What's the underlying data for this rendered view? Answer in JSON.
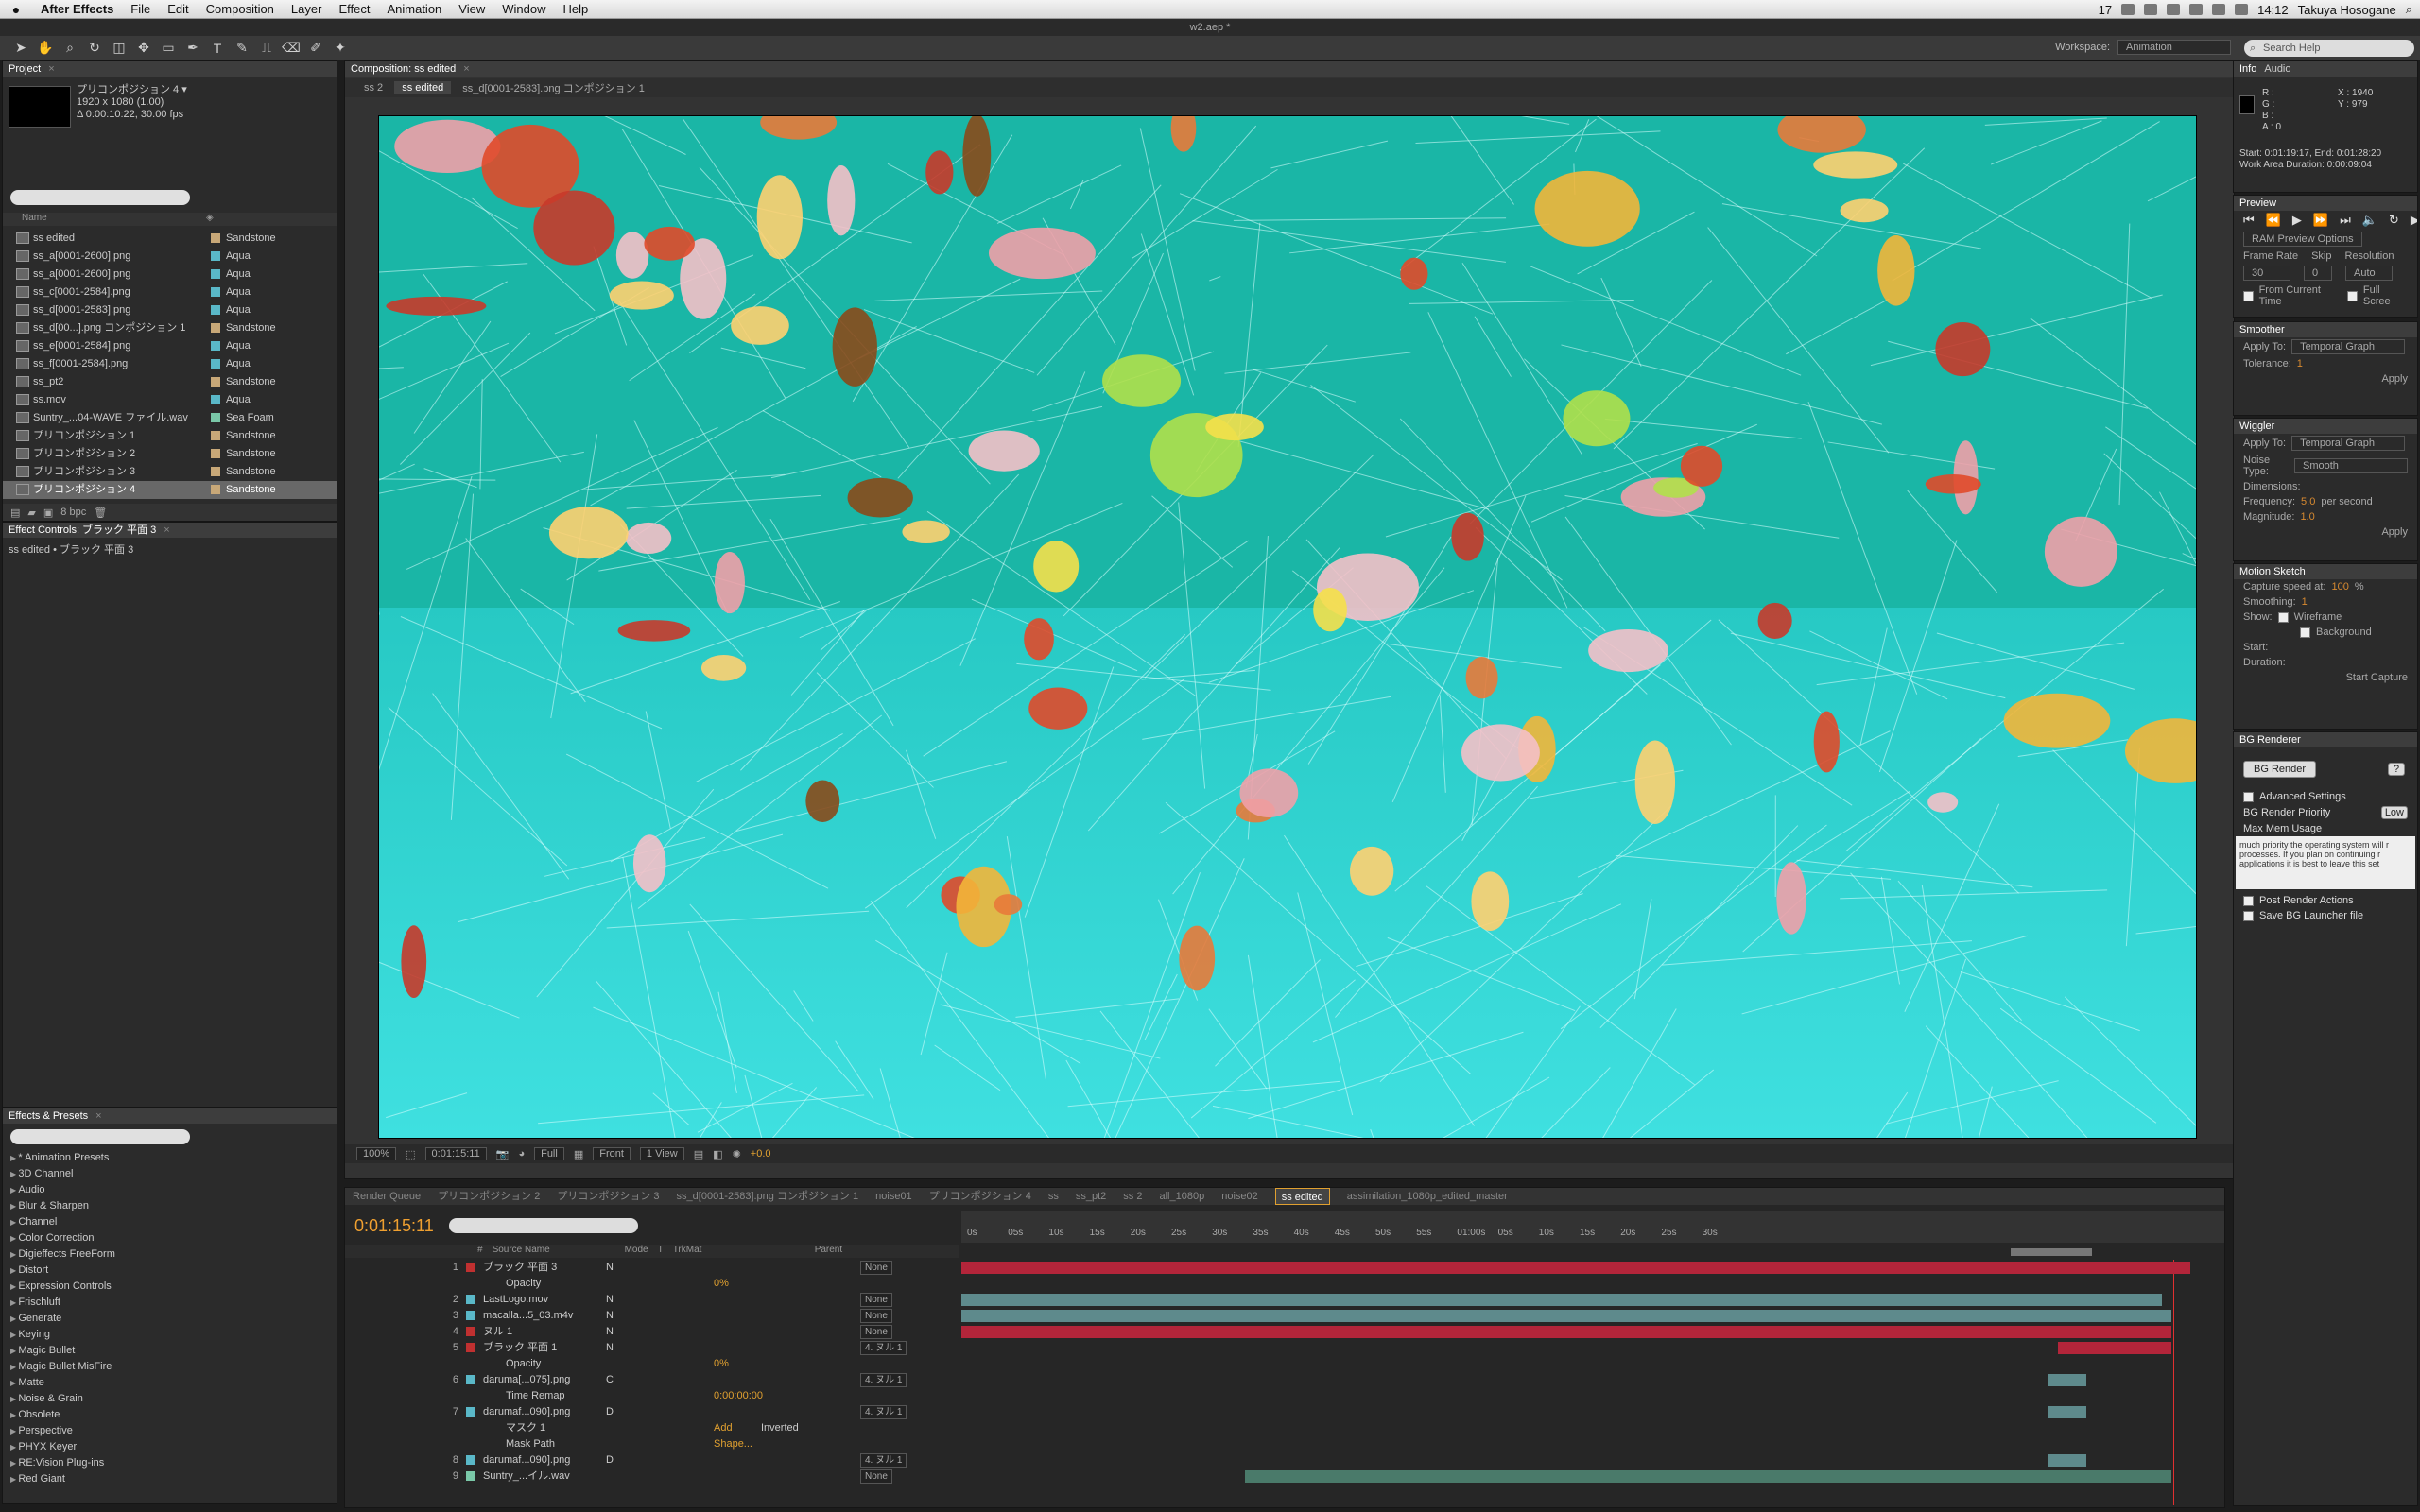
{
  "menubar": {
    "app": "After Effects",
    "menus": [
      "File",
      "Edit",
      "Composition",
      "Layer",
      "Effect",
      "Animation",
      "View",
      "Window",
      "Help"
    ],
    "status_count": "17",
    "clock": "14:12",
    "user": "Takuya Hosogane"
  },
  "window": {
    "title": "w2.aep *"
  },
  "toolbar": {
    "workspace_label": "Workspace:",
    "workspace_value": "Animation",
    "search_help": "Search Help"
  },
  "project": {
    "tab": "Project",
    "selected_name": "プリコンポジション 4 ▾",
    "selected_info": [
      "1920 x 1080 (1.00)",
      "Δ 0:00:10:22, 30.00 fps"
    ],
    "col_name": "Name",
    "items": [
      {
        "name": "ss edited",
        "label": "Sandstone",
        "color": "#c8a878"
      },
      {
        "name": "ss_a[0001-2600].png",
        "label": "Aqua",
        "color": "#5ab8c8"
      },
      {
        "name": "ss_a[0001-2600].png",
        "label": "Aqua",
        "color": "#5ab8c8"
      },
      {
        "name": "ss_c[0001-2584].png",
        "label": "Aqua",
        "color": "#5ab8c8"
      },
      {
        "name": "ss_d[0001-2583].png",
        "label": "Aqua",
        "color": "#5ab8c8"
      },
      {
        "name": "ss_d[00...].png コンポジション 1",
        "label": "Sandstone",
        "color": "#c8a878"
      },
      {
        "name": "ss_e[0001-2584].png",
        "label": "Aqua",
        "color": "#5ab8c8"
      },
      {
        "name": "ss_f[0001-2584].png",
        "label": "Aqua",
        "color": "#5ab8c8"
      },
      {
        "name": "ss_pt2",
        "label": "Sandstone",
        "color": "#c8a878"
      },
      {
        "name": "ss.mov",
        "label": "Aqua",
        "color": "#5ab8c8"
      },
      {
        "name": "Suntry_...04-WAVE ファイル.wav",
        "label": "Sea Foam",
        "color": "#7ac8a8"
      },
      {
        "name": "プリコンポジション 1",
        "label": "Sandstone",
        "color": "#c8a878"
      },
      {
        "name": "プリコンポジション 2",
        "label": "Sandstone",
        "color": "#c8a878"
      },
      {
        "name": "プリコンポジション 3",
        "label": "Sandstone",
        "color": "#c8a878"
      },
      {
        "name": "プリコンポジション 4",
        "label": "Sandstone",
        "color": "#c8a878"
      }
    ],
    "bpc": "8 bpc"
  },
  "effect_controls": {
    "tab": "Effect Controls: ブラック 平面 3",
    "subtitle": "ss edited • ブラック 平面 3"
  },
  "effects_presets": {
    "tab": "Effects & Presets",
    "items": [
      "* Animation Presets",
      "3D Channel",
      "Audio",
      "Blur & Sharpen",
      "Channel",
      "Color Correction",
      "Digieffects FreeForm",
      "Distort",
      "Expression Controls",
      "Frischluft",
      "Generate",
      "Keying",
      "Magic Bullet",
      "Magic Bullet MisFire",
      "Matte",
      "Noise & Grain",
      "Obsolete",
      "Perspective",
      "PHYX Keyer",
      "RE:Vision Plug-ins",
      "Red Giant"
    ]
  },
  "composition": {
    "tab": "Composition: ss edited",
    "breadcrumbs": [
      "ss 2",
      "ss edited",
      "ss_d[0001-2583].png コンポジション 1"
    ],
    "zoom": "100%",
    "timecode": "0:01:15:11",
    "resolution": "Full",
    "view": "Front",
    "views": "1 View",
    "exposure": "+0.0"
  },
  "info": {
    "tabs": [
      "Info",
      "Audio"
    ],
    "rgba": [
      "R :",
      "G :",
      "B :",
      "A : 0"
    ],
    "xy": [
      "X : 1940",
      "Y : 979"
    ],
    "start_end": "Start: 0:01:19:17, End: 0:01:28:20",
    "work_area": "Work Area Duration: 0:00:09:04"
  },
  "preview": {
    "tab": "Preview",
    "options": "RAM Preview Options",
    "frame_rate_label": "Frame Rate",
    "skip_label": "Skip",
    "resolution_label": "Resolution",
    "frame_rate": "30",
    "skip": "0",
    "resolution": "Auto",
    "from_current": "From Current Time",
    "full_screen": "Full Scree"
  },
  "smoother": {
    "tab": "Smoother",
    "apply_to": "Apply To:",
    "apply_val": "Temporal Graph",
    "tolerance": "Tolerance:",
    "tolerance_val": "1",
    "apply": "Apply"
  },
  "wiggler": {
    "tab": "Wiggler",
    "apply_to": "Apply To:",
    "apply_val": "Temporal Graph",
    "noise": "Noise Type:",
    "noise_val": "Smooth",
    "dims": "Dimensions:",
    "freq": "Frequency:",
    "freq_val": "5.0",
    "freq_unit": "per second",
    "mag": "Magnitude:",
    "mag_val": "1.0",
    "apply": "Apply"
  },
  "motion_sketch": {
    "tab": "Motion Sketch",
    "capture": "Capture speed at:",
    "capture_val": "100",
    "capture_unit": "%",
    "smoothing": "Smoothing:",
    "smoothing_val": "1",
    "show": "Show:",
    "wireframe": "Wireframe",
    "background": "Background",
    "start": "Start:",
    "duration": "Duration:",
    "start_capture": "Start Capture"
  },
  "bg_renderer": {
    "tab": "BG Renderer",
    "render_btn": "BG Render",
    "help": "?",
    "advanced": "Advanced Settings",
    "priority": "BG Render Priority",
    "priority_val": "Low",
    "max_mem": "Max Mem Usage",
    "tooltip": "much priority the operating system will r processes. If you plan on continuing r applications it is best to leave this set",
    "post_actions": "Post Render Actions",
    "save_launcher": "Save BG Launcher file"
  },
  "timeline": {
    "tabs": [
      "Render Queue",
      "プリコンポジション 2",
      "プリコンポジション 3",
      "ss_d[0001-2583].png コンポジション 1",
      "noise01",
      "プリコンポジション 4",
      "ss",
      "ss_pt2",
      "ss 2",
      "all_1080p",
      "noise02",
      "ss edited",
      "assimilation_1080p_edited_master"
    ],
    "active_tab": "ss edited",
    "timecode": "0:01:15:11",
    "cols": [
      "#",
      "Source Name",
      "Mode",
      "T",
      "TrkMat",
      "Parent"
    ],
    "ruler": [
      "0s",
      "05s",
      "10s",
      "15s",
      "20s",
      "25s",
      "30s",
      "35s",
      "40s",
      "45s",
      "50s",
      "55s",
      "01:00s",
      "05s",
      "10s",
      "15s",
      "20s",
      "25s",
      "30s"
    ],
    "layers": [
      {
        "num": "1",
        "name": "ブラック 平面 3",
        "mode": "N",
        "color": "#c03030",
        "parent": "None"
      },
      {
        "sub": "Opacity",
        "val": "0%"
      },
      {
        "num": "2",
        "name": "LastLogo.mov",
        "mode": "N",
        "color": "#5ab8c8",
        "parent": "None"
      },
      {
        "num": "3",
        "name": "macalla...5_03.m4v",
        "mode": "N",
        "color": "#5ab8c8",
        "parent": "None"
      },
      {
        "num": "4",
        "name": "ヌル 1",
        "mode": "N",
        "color": "#c03030",
        "parent": "None"
      },
      {
        "num": "5",
        "name": "ブラック 平面 1",
        "mode": "N",
        "color": "#c03030",
        "parent": "4. ヌル 1"
      },
      {
        "sub": "Opacity",
        "val": "0%"
      },
      {
        "num": "6",
        "name": "daruma[...075].png",
        "mode": "C",
        "color": "#5ab8c8",
        "parent": "4. ヌル 1"
      },
      {
        "sub": "Time Remap",
        "val": "0:00:00:00"
      },
      {
        "num": "7",
        "name": "darumaf...090].png",
        "mode": "D",
        "color": "#5ab8c8",
        "parent": "4. ヌル 1"
      },
      {
        "sub": "マスク 1",
        "val": "Add",
        "extra": "Inverted"
      },
      {
        "sub": "Mask Path",
        "val": "Shape..."
      },
      {
        "num": "8",
        "name": "darumaf...090].png",
        "mode": "D",
        "color": "#5ab8c8",
        "parent": "4. ヌル 1"
      },
      {
        "num": "9",
        "name": "Suntry_...イル.wav",
        "mode": "",
        "color": "#7ac8a8",
        "parent": "None"
      }
    ]
  }
}
